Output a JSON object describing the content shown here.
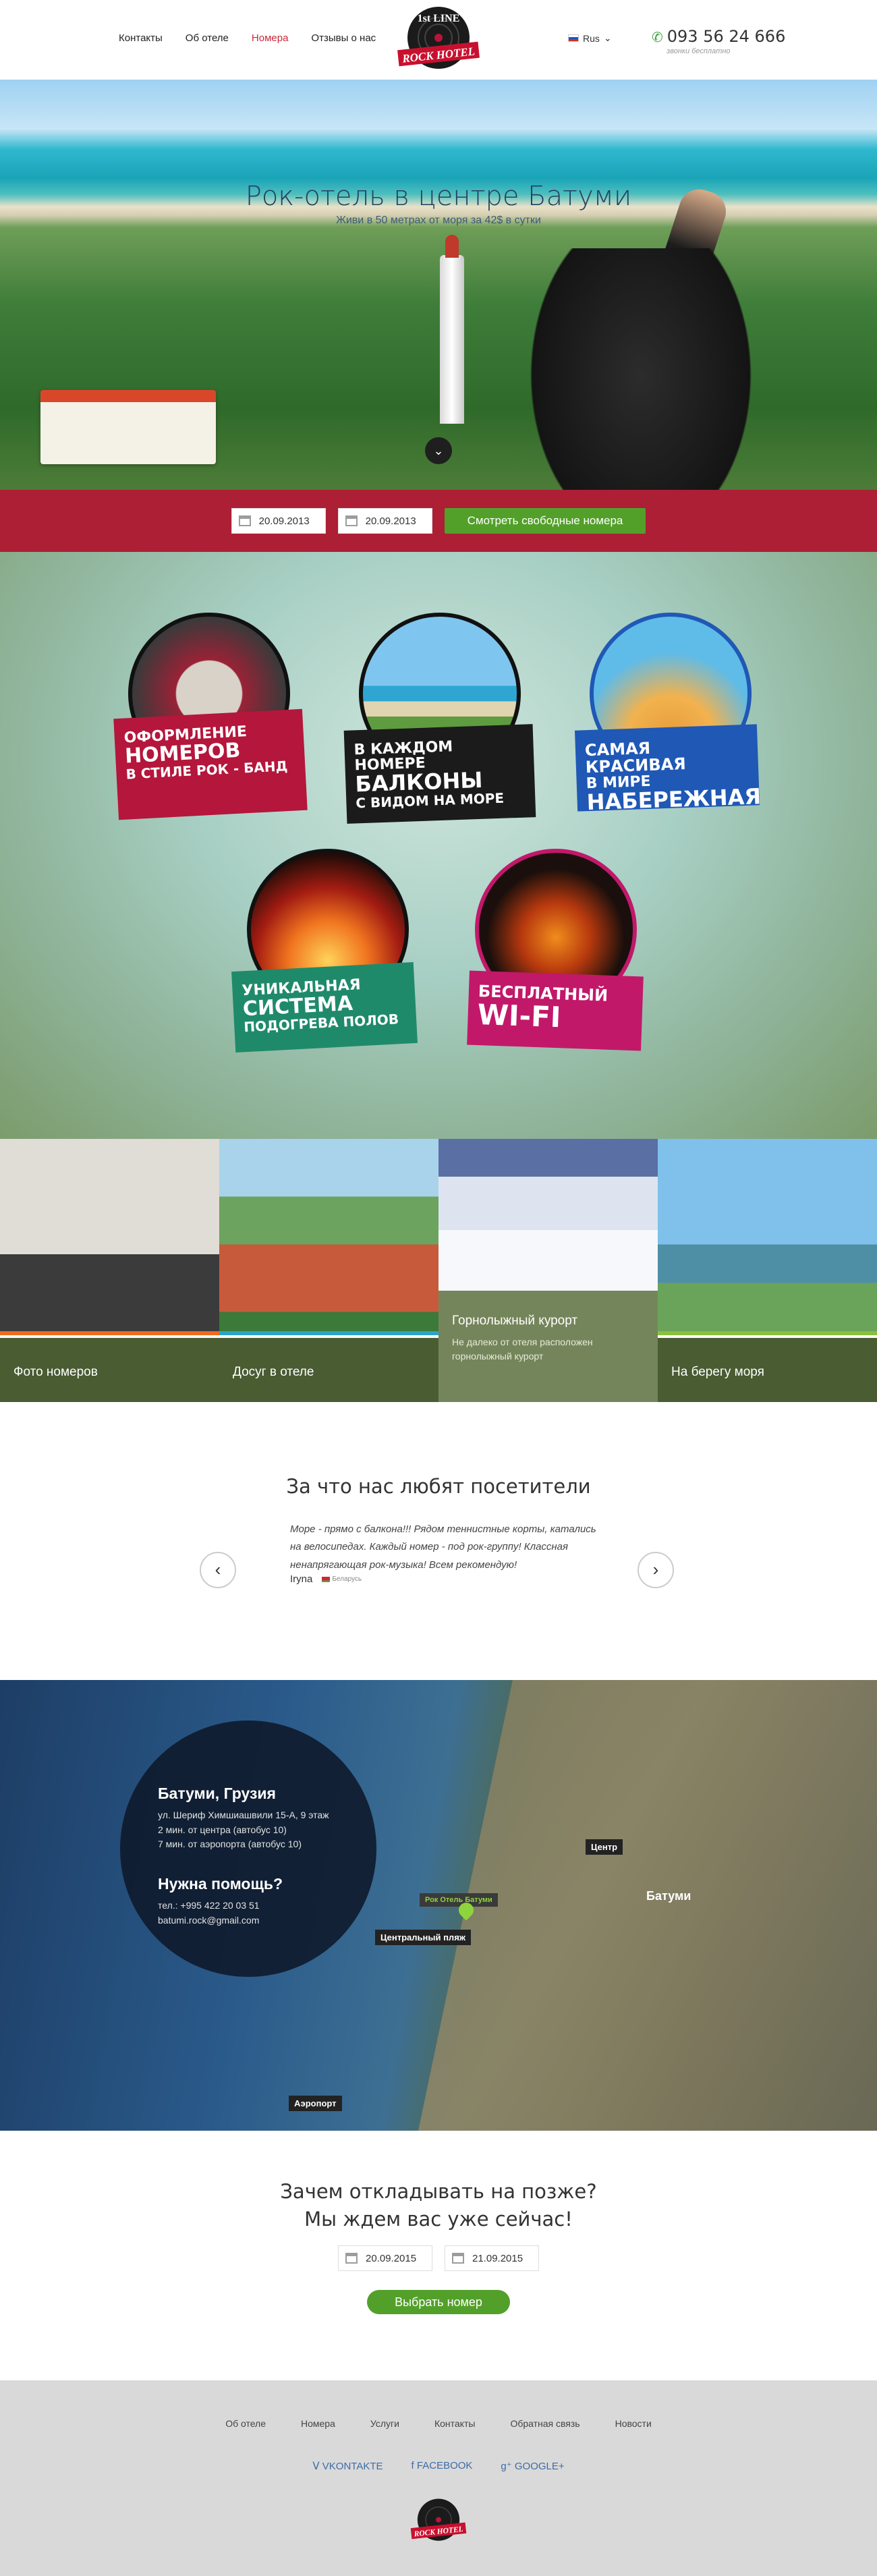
{
  "header": {
    "nav": [
      "Контакты",
      "Об отеле",
      "Номера",
      "Отзывы о нас"
    ],
    "logo_text": "ROCK HOTEL",
    "logo_line": "1st LINE",
    "lang": "Rus",
    "phone": "093 56 24 666",
    "phone_note": "звонки бесплатно"
  },
  "hero": {
    "title": "Рок-отель в центре Батуми",
    "subtitle": "Живи в 50 метрах от моря за 42$ в сутки",
    "scroll_icon": "chevron-down-icon"
  },
  "booking": {
    "date_from": "20.09.2013",
    "date_to": "20.09.2013",
    "button": "Смотреть свободные номера"
  },
  "features": [
    {
      "line1": "ОФОРМЛЕНИЕ",
      "line2": "НОМЕРОВ",
      "line3": "В СТИЛЕ РОК - БАНД",
      "color": "#b5163c"
    },
    {
      "line1": "В КАЖДОМ НОМЕРЕ",
      "line2": "БАЛКОНЫ",
      "line3": "С ВИДОМ НА МОРЕ",
      "color": "#1b1b1b"
    },
    {
      "line1": "САМАЯ КРАСИВАЯ",
      "line2": "В МИРЕ",
      "line3": "НАБЕРЕЖНАЯ",
      "color": "#1f58b5"
    },
    {
      "line1": "УНИКАЛЬНАЯ",
      "line2": "СИСТЕМА",
      "line3": "ПОДОГРЕВА ПОЛОВ",
      "color": "#1f8a6a"
    },
    {
      "line1": "БЕСПЛАТНЫЙ",
      "line2": "WI-FI",
      "line3": "",
      "color": "#c2186a"
    }
  ],
  "gallery": [
    {
      "caption": "Фото номеров",
      "desc": ""
    },
    {
      "caption": "Досуг в отеле",
      "desc": ""
    },
    {
      "caption": "Горнолыжный курорт",
      "desc": "Не далеко от отеля расположен горнолыжный курорт"
    },
    {
      "caption": "На берегу моря",
      "desc": ""
    }
  ],
  "reviews": {
    "title": "За что нас любят посетители",
    "text": "Море - прямо с балкона!!! Рядом теннистные корты, катались на велосипедах. Каждый номер - под рок-группу! Классная ненапрягающая рок-музыка! Всем рекомендую!",
    "author": "Iryna",
    "country": "Беларусь",
    "prev_icon": "arrow-left-icon",
    "next_icon": "arrow-right-icon"
  },
  "map": {
    "city": "Батуми, Грузия",
    "address": "ул. Шериф Химшиашвили 15-А, 9 этаж",
    "dist1": "2 мин. от центра (автобус 10)",
    "dist2": "7 мин. от аэропорта (автобус 10)",
    "help_title": "Нужна помощь?",
    "tel": "тел.: +995 422 20 03 51",
    "email": "batumi.rock@gmail.com",
    "labels": {
      "hotel": "Рок Отель Батуми",
      "center": "Центр",
      "beach": "Центральный пляж",
      "airport": "Аэропорт",
      "city": "Батуми"
    }
  },
  "cta": {
    "line1": "Зачем откладывать на позже?",
    "line2": "Мы ждем вас уже сейчас!",
    "date_from": "20.09.2015",
    "date_to": "21.09.2015",
    "button": "Выбрать номер"
  },
  "footer": {
    "nav": [
      "Об отеле",
      "Номера",
      "Услуги",
      "Контакты",
      "Обратная связь",
      "Новости"
    ],
    "social": [
      "VKONTAKTE",
      "FACEBOOK",
      "GOOGLE+"
    ]
  },
  "colors": {
    "brand_red": "#ac1f35",
    "accent_green": "#52a02a",
    "nav_active": "#c82a3b"
  }
}
